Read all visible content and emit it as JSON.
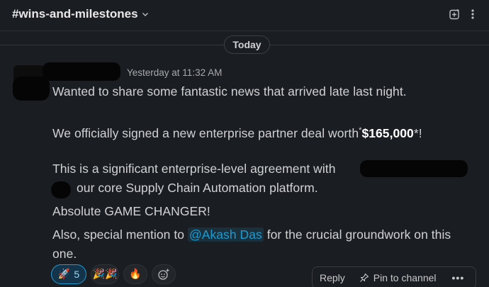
{
  "channel": {
    "name": "#wins-and-milestones"
  },
  "header": {
    "icons": [
      "canvas-add-icon",
      "more-vertical-icon"
    ]
  },
  "divider": {
    "label": "Today"
  },
  "message": {
    "timestamp": "Yesterday at 11:32 AM",
    "line1": "Wanted to share some fantastic news that arrived late last night.",
    "line2_prefix": "We officially signed a new enterprise partner deal worth",
    "line2_asterisk_open": "*",
    "line2_amount": "$165,000",
    "line2_suffix": "*!",
    "line3": "This is a significant enterprise-level agreement with",
    "line4": "our core Supply Chain Automation platform.",
    "line5": "Absolute GAME CHANGER!",
    "line6_prefix": "Also, special mention to ",
    "line6_mention": "@Akash Das",
    "line6_suffix": " for the crucial groundwork on this",
    "line7": "one."
  },
  "reactions": [
    {
      "icon": "rocket-icon",
      "glyph": "🚀",
      "count": "5",
      "active": true
    },
    {
      "icon": "party-popper-icon",
      "glyph": "🎉🎉",
      "count": "",
      "active": false
    },
    {
      "icon": "fire-icon",
      "glyph": "🔥",
      "count": "",
      "active": false
    }
  ],
  "add_reaction": {
    "icon": "add-reaction-icon"
  },
  "actions": {
    "reply": "Reply",
    "pin": "Pin to channel",
    "more": "•••"
  },
  "colors": {
    "background": "#1a1d21",
    "accent": "#1d9bd1",
    "text": "#d1d2d3"
  }
}
